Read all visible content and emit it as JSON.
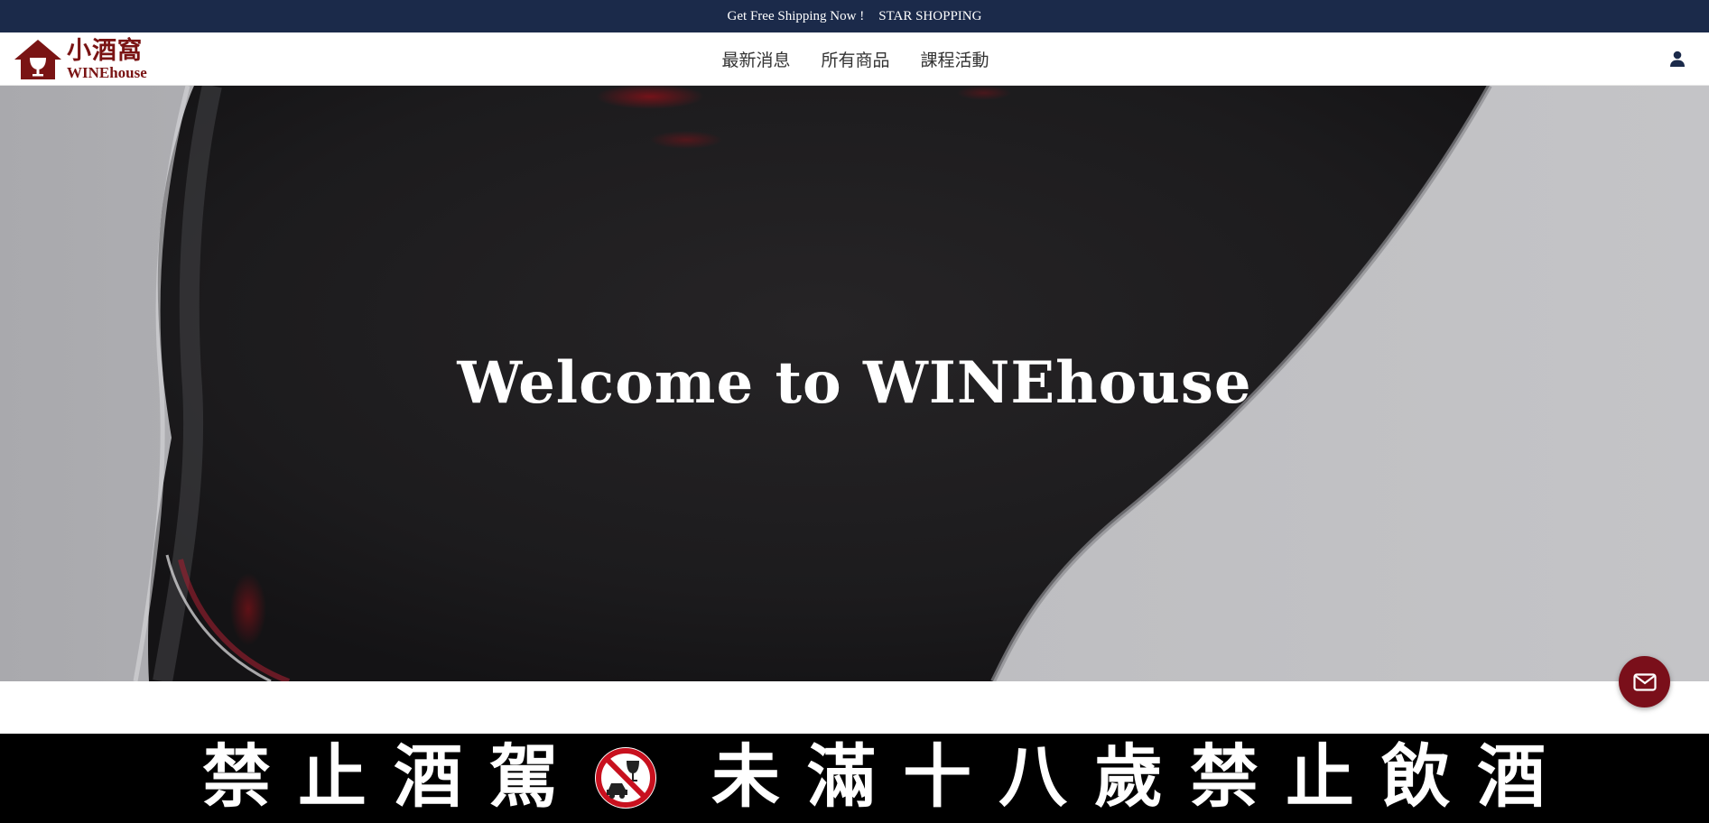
{
  "announcement": {
    "text": "Get Free Shipping Now !",
    "link": "STAR SHOPPING"
  },
  "brand": {
    "name_cn": "小酒窩",
    "name_en": "WINEhouse",
    "color": "#7a1414"
  },
  "nav": {
    "items": [
      {
        "label": "最新消息"
      },
      {
        "label": "所有商品"
      },
      {
        "label": "課程活動"
      }
    ]
  },
  "header_icons": {
    "account": "user-icon"
  },
  "hero": {
    "title": "Welcome to WINEhouse"
  },
  "warning_banner": {
    "left_text": "禁止酒駕",
    "right_text": "未滿十八歲禁止飲酒",
    "icon": "no-drink-driving-icon",
    "icon_color": "#c8101e"
  },
  "floating": {
    "contact": "mail-icon",
    "color": "#7a0f1a"
  },
  "colors": {
    "topbar": "#1b2a4a",
    "hero_wine": "#1e1d1f",
    "hero_glass_bg": "#b8b8bb"
  }
}
